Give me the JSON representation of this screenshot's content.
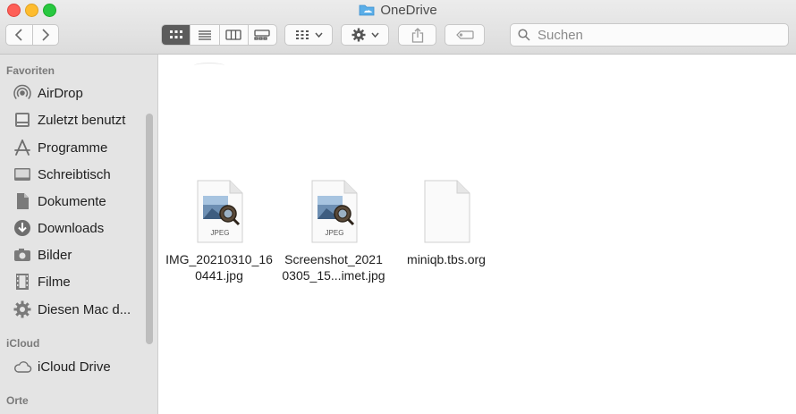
{
  "window": {
    "title": "OneDrive"
  },
  "toolbar": {
    "search_placeholder": "Suchen"
  },
  "sidebar": {
    "sections": [
      {
        "header": "Favoriten",
        "items": [
          {
            "label": "AirDrop",
            "icon": "airdrop-icon"
          },
          {
            "label": "Zuletzt benutzt",
            "icon": "recents-icon"
          },
          {
            "label": "Programme",
            "icon": "applications-icon"
          },
          {
            "label": "Schreibtisch",
            "icon": "desktop-icon"
          },
          {
            "label": "Dokumente",
            "icon": "document-icon"
          },
          {
            "label": "Downloads",
            "icon": "downloads-icon"
          },
          {
            "label": "Bilder",
            "icon": "camera-icon"
          },
          {
            "label": "Filme",
            "icon": "film-icon"
          },
          {
            "label": "Diesen Mac d...",
            "icon": "gear-icon"
          }
        ]
      },
      {
        "header": "iCloud",
        "items": [
          {
            "label": "iCloud Drive",
            "icon": "cloud-icon"
          }
        ]
      },
      {
        "header": "Orte",
        "items": []
      }
    ]
  },
  "files": [
    {
      "name_line1": "IMG_20210310_16",
      "name_line2": "0441.jpg",
      "badge": "JPEG",
      "icon": "jpeg-preview-icon"
    },
    {
      "name_line1": "Screenshot_2021",
      "name_line2": "0305_15...imet.jpg",
      "badge": "JPEG",
      "icon": "jpeg-preview-icon"
    },
    {
      "name_line1": "miniqb.tbs.org",
      "name_line2": "",
      "badge": "",
      "icon": "blank-document-icon"
    }
  ]
}
